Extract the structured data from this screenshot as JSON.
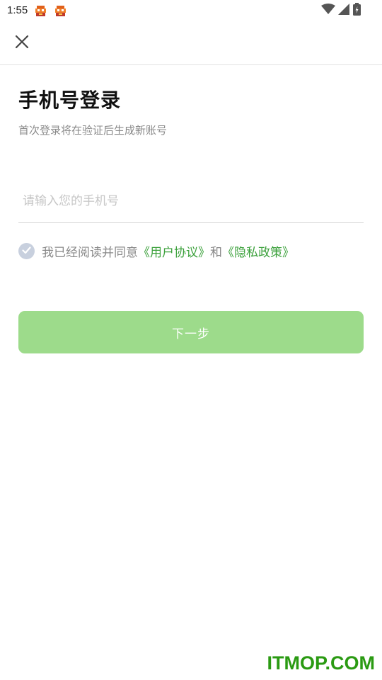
{
  "status_bar": {
    "time": "1:55",
    "icons": [
      "notification-app-icon",
      "notification-app-icon",
      "wifi-icon",
      "cellular-signal-icon",
      "battery-charging-icon"
    ]
  },
  "app_bar": {
    "close_icon": "close-icon"
  },
  "login": {
    "title": "手机号登录",
    "subtitle": "首次登录将在验证后生成新账号",
    "phone_placeholder": "请输入您的手机号",
    "phone_value": ""
  },
  "agreement": {
    "prefix": "我已经阅读并同意",
    "user_agreement": "《用户协议》",
    "conjunction": "和",
    "privacy_policy": "《隐私政策》",
    "check_icon": "check-circle-icon",
    "checked": false
  },
  "actions": {
    "next_label": "下一步"
  },
  "watermark": {
    "text": "ITMOP.COM"
  },
  "colors": {
    "accent_green": "#3aa03a",
    "button_disabled": "#9ddb8b",
    "watermark_green": "#2a9a12"
  }
}
